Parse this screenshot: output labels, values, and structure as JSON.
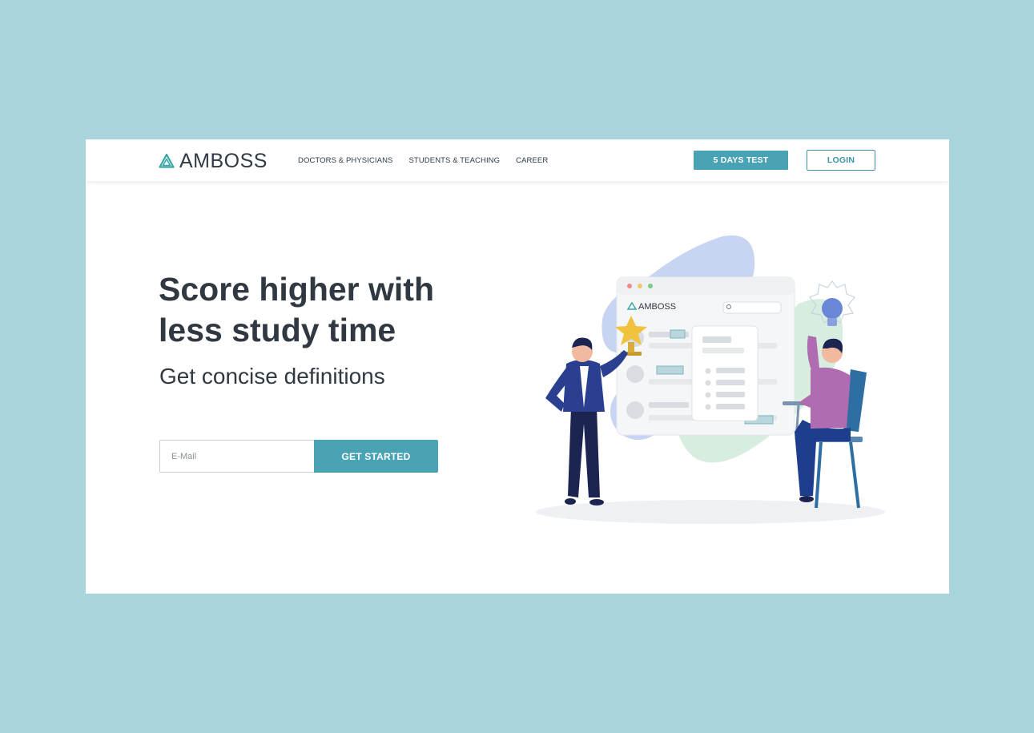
{
  "brand": {
    "name": "AMBOSS",
    "color": "#4aa3b5"
  },
  "nav": {
    "links": [
      {
        "label": "DOCTORS & PHYSICIANS"
      },
      {
        "label": "STUDENTS & TEACHING"
      },
      {
        "label": "CAREER"
      }
    ],
    "trial_button": "5 DAYS TEST",
    "login_button": "LOGIN"
  },
  "hero": {
    "title": "Score higher with less study time",
    "subtitle": "Get concise definitions",
    "email_placeholder": "E-Mail",
    "cta": "GET STARTED"
  },
  "illustration": {
    "window_brand": "AMBOSS",
    "icons": [
      "trophy-icon",
      "lightbulb-icon",
      "search-icon"
    ]
  }
}
